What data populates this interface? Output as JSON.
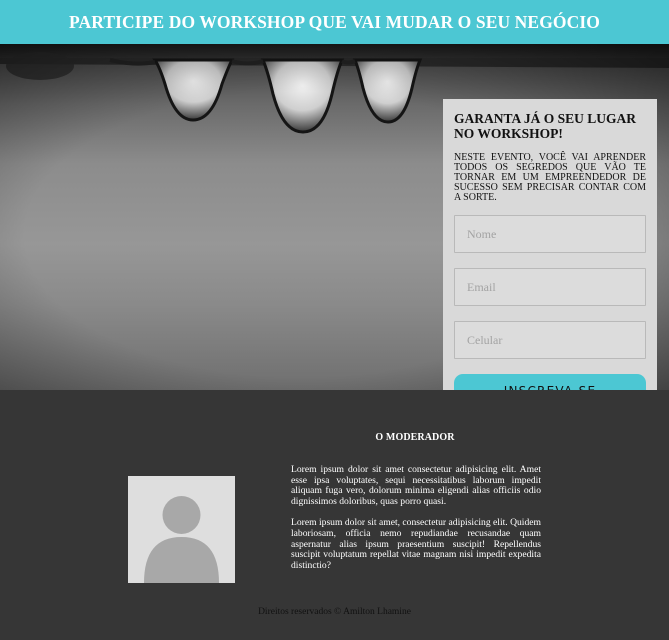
{
  "header": {
    "title": "PARTICIPE DO WORKSHOP QUE VAI MUDAR O SEU NEGÓCIO"
  },
  "form": {
    "title": "GARANTA JÁ O SEU LUGAR NO WORKSHOP!",
    "description": "NESTE EVENTO, VOCÊ VAI APRENDER TODOS OS SEGREDOS QUE VÃO TE TORNAR EM UM EMPREENDEDOR DE SUCESSO SEM PRECISAR CONTAR COM A SORTE.",
    "name_placeholder": "Nome",
    "email_placeholder": "Email",
    "phone_placeholder": "Celular",
    "submit_label": "INSCREVA-SE"
  },
  "moderator": {
    "title": "O MODERADOR",
    "avatar_icon": "user-silhouette-icon",
    "bio_1": "Lorem ipsum dolor sit amet consectetur adipisicing elit. Amet esse ipsa voluptates, sequi necessitatibus laborum impedit aliquam fuga vero, dolorum minima eligendi alias officiis odio dignissimos doloribus, quas porro quasi.",
    "bio_2": "Lorem ipsum dolor sit amet, consectetur adipisicing elit. Quidem laboriosam, officia nemo repudiandae recusandae quam aspernatur alias ipsum praesentium suscipit! Repellendus suscipit voluptatum repellat vitae magnam nisi impedit expedita distinctio?"
  },
  "footer": {
    "copyright": "Direitos reservados © Amilton Lhamine"
  },
  "colors": {
    "accent": "#4cc7d3",
    "dark_section": "#363636",
    "card": "#d9d9d9"
  }
}
